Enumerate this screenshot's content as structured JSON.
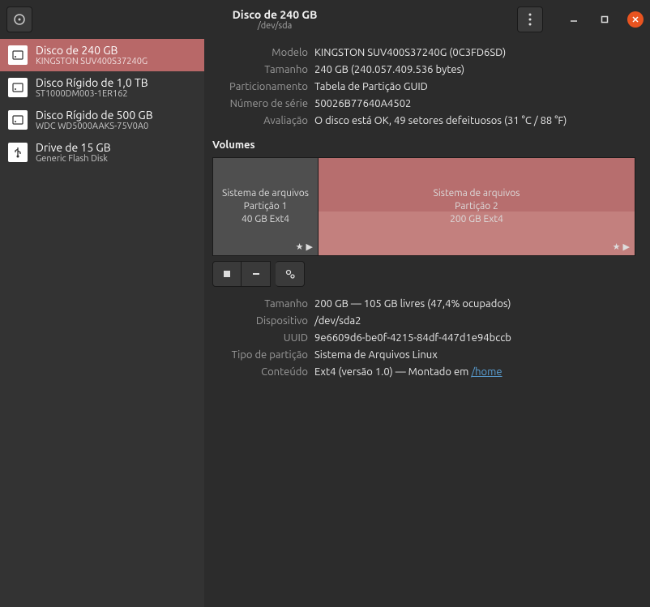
{
  "titlebar": {
    "title": "Disco de 240 GB",
    "subtitle": "/dev/sda"
  },
  "sidebar": {
    "items": [
      {
        "name": "Disco de 240 GB",
        "model": "KINGSTON SUV400S37240G",
        "icon": "hdd"
      },
      {
        "name": "Disco Rígido de 1,0 TB",
        "model": "ST1000DM003-1ER162",
        "icon": "hdd"
      },
      {
        "name": "Disco Rígido de 500 GB",
        "model": "WDC WD5000AAKS-75V0A0",
        "icon": "hdd"
      },
      {
        "name": "Drive de 15 GB",
        "model": "Generic Flash Disk",
        "icon": "usb"
      }
    ]
  },
  "info": {
    "labels": {
      "modelo": "Modelo",
      "tamanho": "Tamanho",
      "part": "Particionamento",
      "serie": "Número de série",
      "aval": "Avaliação"
    },
    "modelo": "KINGSTON SUV400S37240G (0C3FD6SD)",
    "tamanho": "240 GB (240.057.409.536 bytes)",
    "part": "Tabela de Partição GUID",
    "serie": "50026B77640A4502",
    "aval": "O disco está OK, 49 setores defeituosos (31 °C / 88 °F)"
  },
  "volumes": {
    "title": "Volumes",
    "p1": {
      "l1": "Sistema de arquivos",
      "l2": "Partição 1",
      "l3": "40 GB Ext4"
    },
    "p2": {
      "l1": "Sistema de arquivos",
      "l2": "Partição 2",
      "l3": "200 GB Ext4"
    }
  },
  "detail": {
    "labels": {
      "tamanho": "Tamanho",
      "disp": "Dispositivo",
      "uuid": "UUID",
      "tipo": "Tipo de partição",
      "cont": "Conteúdo"
    },
    "tamanho": "200 GB — 105 GB livres (47,4% ocupados)",
    "disp": "/dev/sda2",
    "uuid": "9e6609d6-be0f-4215-84df-447d1e94bccb",
    "tipo": "Sistema de Arquivos Linux",
    "cont_prefix": "Ext4 (versão 1.0) — Montado em ",
    "cont_link": "/home"
  }
}
